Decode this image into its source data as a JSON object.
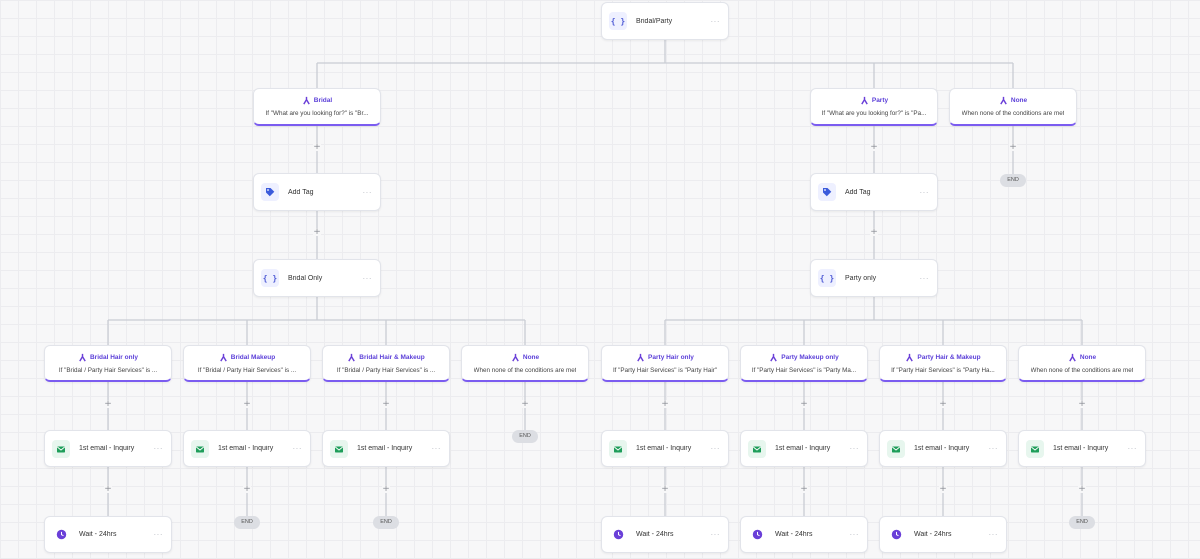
{
  "top_node": {
    "label": "Bridal/Party",
    "icon": "curly-braces-icon"
  },
  "branches_main": {
    "bridal": {
      "title": "Bridal",
      "condition": "If \"What are you looking for?\" is \"Br..."
    },
    "party": {
      "title": "Party",
      "condition": "If \"What are you looking for?\" is \"Pa..."
    },
    "none": {
      "title": "None",
      "condition": "When none of the conditions are met"
    }
  },
  "bridal_path": {
    "add_tag": "Add Tag",
    "condition_node": "Bridal Only"
  },
  "party_path": {
    "add_tag": "Add Tag",
    "condition_node": "Party only"
  },
  "sub_branches": [
    {
      "title": "Bridal Hair only",
      "condition": "If \"Bridal / Party Hair Services\" is ..."
    },
    {
      "title": "Bridal Makeup",
      "condition": "If \"Bridal / Party Hair Services\" is ..."
    },
    {
      "title": "Bridal Hair & Makeup",
      "condition": "If \"Bridal / Party Hair Services\" is ..."
    },
    {
      "title": "None",
      "condition": "When none of the conditions are met"
    },
    {
      "title": "Party Hair only",
      "condition": "If \"Party Hair Services\" is \"Party Hair\""
    },
    {
      "title": "Party Makeup only",
      "condition": "If \"Party Hair Services\" is \"Party Ma..."
    },
    {
      "title": "Party Hair & Makeup",
      "condition": "If \"Party Hair Services\" is \"Party Ha..."
    },
    {
      "title": "None",
      "condition": "When none of the conditions are met"
    }
  ],
  "email_label": "1st email - Inquiry",
  "wait_label": "Wait - 24hrs",
  "end_label": "END",
  "plus_symbol": "+",
  "more_symbol": "···",
  "colors": {
    "branch_accent": "#7b5cf0",
    "tag_icon": "#3b5bdb",
    "email_icon": "#1e9e5a",
    "wait_icon": "#6a3fd8",
    "connector": "#c9ccd3"
  }
}
